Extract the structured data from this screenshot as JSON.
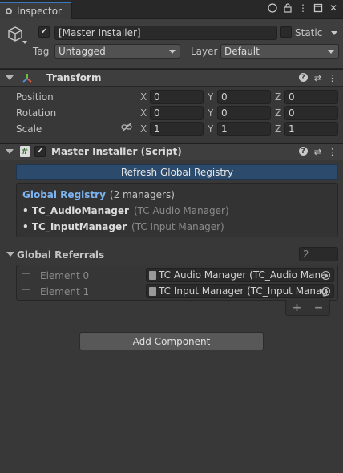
{
  "tab": {
    "title": "Inspector"
  },
  "window_icons": [
    "more-icon",
    "lock-icon",
    "maximize-icon",
    "close-icon"
  ],
  "gameobject": {
    "active": true,
    "name": "[Master Installer]",
    "static_label": "Static",
    "static_checked": false,
    "tag_label": "Tag",
    "tag_value": "Untagged",
    "layer_label": "Layer",
    "layer_value": "Default"
  },
  "transform": {
    "title": "Transform",
    "rows": [
      {
        "label": "Position",
        "x": "0",
        "y": "0",
        "z": "0"
      },
      {
        "label": "Rotation",
        "x": "0",
        "y": "0",
        "z": "0"
      },
      {
        "label": "Scale",
        "x": "1",
        "y": "1",
        "z": "1"
      }
    ],
    "axes": {
      "x": "X",
      "y": "Y",
      "z": "Z"
    }
  },
  "script": {
    "title": "Master Installer (Script)",
    "enabled": true,
    "refresh_button": "Refresh Global Registry",
    "registry": {
      "title": "Global Registry",
      "count": "(2 managers)",
      "items": [
        {
          "name": "• TC_AudioManager",
          "type": "(TC Audio Manager)"
        },
        {
          "name": "• TC_InputManager",
          "type": "(TC Input Manager)"
        }
      ]
    },
    "referrals": {
      "label": "Global Referrals",
      "size": "2",
      "elements": [
        {
          "label": "Element 0",
          "value": "TC Audio Manager (TC_Audio Mana"
        },
        {
          "label": "Element 1",
          "value": "TC Input Manager (TC_Input Manag"
        }
      ],
      "add": "+",
      "remove": "−"
    }
  },
  "add_component": "Add Component",
  "colors": {
    "background": "#383838",
    "accent_tab": "#3a79bb",
    "refresh_button": "#2b4a6c",
    "registry_title": "#7cb4f2"
  }
}
